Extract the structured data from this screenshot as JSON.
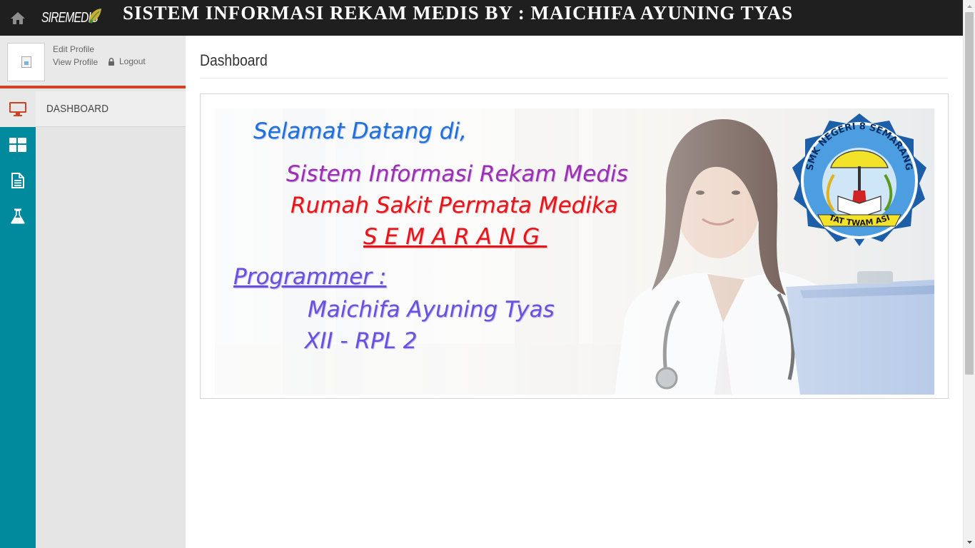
{
  "topbar": {
    "brand": "SIREMEDIS",
    "title": "SISTEM INFORMASI REKAM MEDIS BY : MAICHIFA AYUNING TYAS"
  },
  "sidebar": {
    "profile": {
      "edit_profile": "Edit Profile",
      "view_profile": "View Profile",
      "logout": "Logout"
    },
    "menu": [
      {
        "label": "DASHBOARD",
        "icon": "desktop-icon",
        "active": true
      }
    ],
    "rail_icons": [
      "dashboard-grid-icon",
      "document-icon",
      "flask-icon"
    ]
  },
  "main": {
    "page_title": "Dashboard",
    "banner": {
      "welcome": "Selamat Datang di,",
      "system": "Sistem Informasi Rekam Medis",
      "hospital": "Rumah Sakit Permata Medika",
      "city": "SEMARANG",
      "programmer_label": "Programmer :",
      "programmer_name": "Maichifa Ayuning Tyas",
      "programmer_class": "XII - RPL 2",
      "logo_text_top": "SMK NEGERI 8 SEMARANG",
      "logo_text_bottom": "TAT TWAM ASI"
    }
  },
  "colors": {
    "topbar": "#1f1f1f",
    "rail": "#01899e",
    "accent": "#d14124",
    "sidebar": "#e5e5e5"
  }
}
